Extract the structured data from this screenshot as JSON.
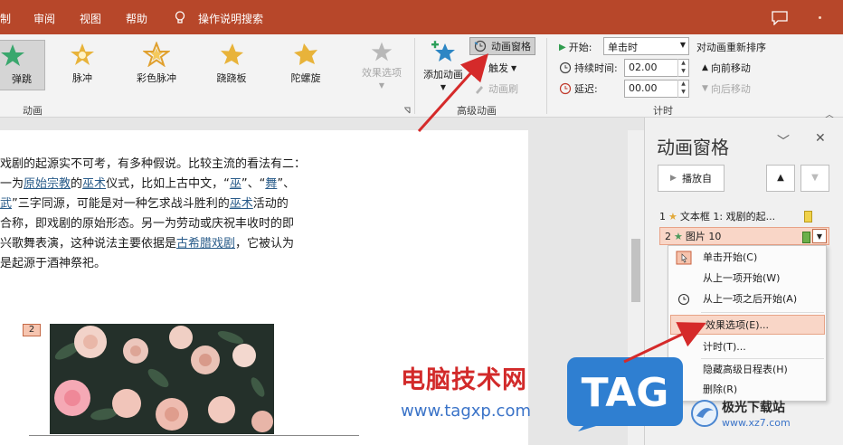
{
  "menubar": {
    "items": [
      "制",
      "审阅",
      "视图",
      "帮助"
    ],
    "search_label": "操作说明搜索"
  },
  "ribbon": {
    "animations": [
      {
        "label": "弹跳",
        "icon": "bounce-star-icon",
        "selected": true
      },
      {
        "label": "脉冲",
        "icon": "pulse-star-icon"
      },
      {
        "label": "彩色脉冲",
        "icon": "color-pulse-star-icon"
      },
      {
        "label": "跷跷板",
        "icon": "teeter-star-icon"
      },
      {
        "label": "陀螺旋",
        "icon": "spin-star-icon"
      }
    ],
    "effect_options": "效果选项",
    "animation_group_label": "动画",
    "add_animation": "添加动画",
    "animation_pane": "动画窗格",
    "trigger": "触发",
    "animation_painter": "动画刷",
    "advanced_group_label": "高级动画",
    "start_label": "开始:",
    "start_value": "单击时",
    "duration_label": "持续时间:",
    "duration_value": "02.00",
    "delay_label": "延迟:",
    "delay_value": "00.00",
    "timing_group_label": "计时",
    "reorder_title": "对动画重新排序",
    "move_earlier": "向前移动",
    "move_later": "向后移动"
  },
  "document": {
    "lines": [
      [
        {
          "t": "戏剧的起源实不可考，有多种假说。比较主流的看法有二："
        }
      ],
      [
        {
          "t": "一为"
        },
        {
          "t": "原始宗教",
          "link": true
        },
        {
          "t": "的"
        },
        {
          "t": "巫术",
          "link": true
        },
        {
          "t": "仪式，比如上古中文，“"
        },
        {
          "t": "巫",
          "link": true
        },
        {
          "t": "”、“"
        },
        {
          "t": "舞",
          "link": true
        },
        {
          "t": "”、"
        }
      ],
      [
        {
          "t": "武",
          "link": true
        },
        {
          "t": "”三字同源，可能是对一种乞求战斗胜利的"
        },
        {
          "t": "巫术",
          "link": true
        },
        {
          "t": "活动的"
        }
      ],
      [
        {
          "t": "合称，即戏剧的原始形态。另一为劳动或庆祝丰收时的即"
        }
      ],
      [
        {
          "t": "兴歌舞表演，这种说法主要依据是"
        },
        {
          "t": "古希腊戏剧",
          "link": true
        },
        {
          "t": "，它被认为"
        }
      ],
      [
        {
          "t": "是起源于酒神祭祀。"
        }
      ]
    ],
    "image_badge": "2"
  },
  "pane": {
    "title": "动画窗格",
    "play_from": "播放自",
    "rows": [
      {
        "num": "1",
        "label": "文本框 1: 戏剧的起...",
        "star": "gold",
        "marker": "#f0d24a"
      },
      {
        "num": "2",
        "label": "图片 10",
        "star": "green",
        "marker": "#6bb04a",
        "selected": true
      }
    ]
  },
  "context_menu": {
    "items": [
      {
        "label": "单击开始(C)",
        "icon": "mouse-click-icon"
      },
      {
        "label": "从上一项开始(W)"
      },
      {
        "label": "从上一项之后开始(A)",
        "icon": "clock-icon"
      },
      {
        "label": "效果选项(E)...",
        "highlight": true
      },
      {
        "label": "计时(T)..."
      },
      {
        "label": "隐藏高级日程表(H)"
      },
      {
        "label": "删除(R)"
      }
    ]
  },
  "watermarks": {
    "site_name": "电脑技术网",
    "site_url": "www.tagxp.com",
    "tag_logo": "TAG",
    "bottom_logo": "极光下载站",
    "bottom_url": "www.xz7.com"
  },
  "colors": {
    "title_bar": "#b7472a",
    "selection": "#f9d6c7",
    "link": "#2a5c8a",
    "arrow": "#d52a2a"
  }
}
